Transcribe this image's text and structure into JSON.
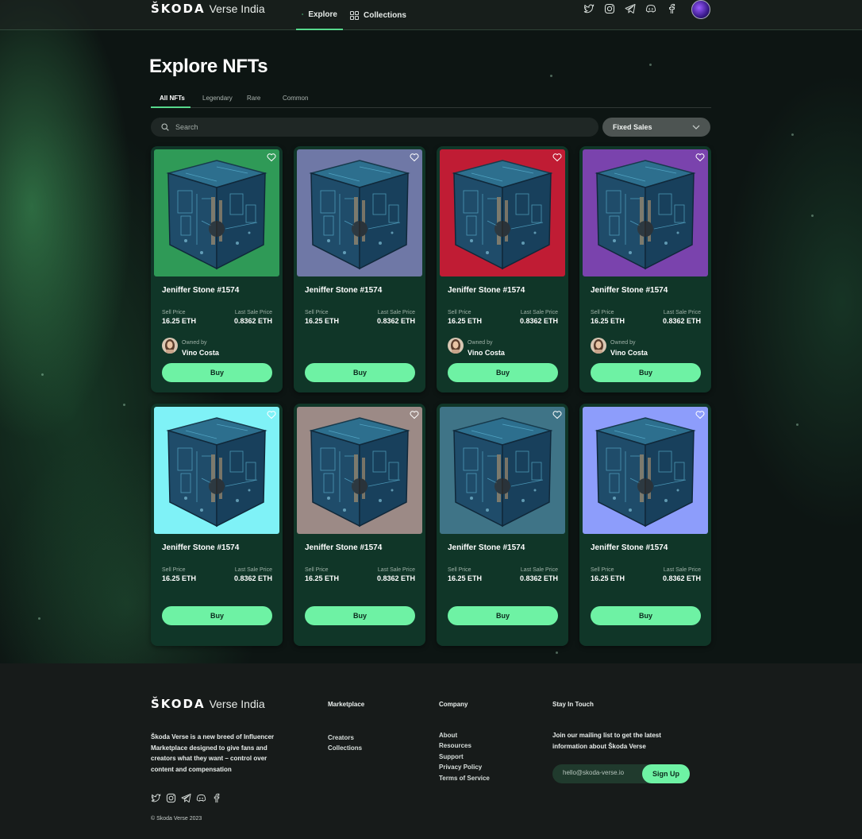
{
  "header": {
    "brand_logo": "ŠKODA",
    "brand_sub": "Verse India",
    "nav": [
      {
        "label": "Explore",
        "icon": "asterisk-icon",
        "active": true
      },
      {
        "label": "Collections",
        "icon": "grid-icon",
        "active": false
      }
    ],
    "socials": [
      "twitter-icon",
      "instagram-icon",
      "telegram-icon",
      "discord-icon",
      "facebook-icon"
    ]
  },
  "page": {
    "title": "Explore NFTs",
    "tabs": [
      "All NFTs",
      "Legendary",
      "Rare",
      "Common"
    ],
    "active_tab": "All NFTs",
    "search_placeholder": "Search",
    "filter_label": "Fixed Sales"
  },
  "labels": {
    "sell_price": "Sell Price",
    "last_sale_price": "Last Sale Price",
    "owned_by": "Owned by",
    "buy": "Buy"
  },
  "cards": [
    {
      "name": "Jeniffer Stone #1574",
      "sell_price": "16.25 ETH",
      "last_sale": "0.8362 ETH",
      "owner": "Vino Costa",
      "bg": "#2f9a57"
    },
    {
      "name": "Jeniffer Stone #1574",
      "sell_price": "16.25 ETH",
      "last_sale": "0.8362 ETH",
      "owner": null,
      "bg": "#6f78a6"
    },
    {
      "name": "Jeniffer Stone #1574",
      "sell_price": "16.25 ETH",
      "last_sale": "0.8362 ETH",
      "owner": "Vino Costa",
      "bg": "#c01c34"
    },
    {
      "name": "Jeniffer Stone #1574",
      "sell_price": "16.25 ETH",
      "last_sale": "0.8362 ETH",
      "owner": "Vino Costa",
      "bg": "#7a43ad"
    },
    {
      "name": "Jeniffer Stone #1574",
      "sell_price": "16.25 ETH",
      "last_sale": "0.8362 ETH",
      "owner": null,
      "bg": "#7ff2f7"
    },
    {
      "name": "Jeniffer Stone #1574",
      "sell_price": "16.25 ETH",
      "last_sale": "0.8362 ETH",
      "owner": null,
      "bg": "#9c8a86"
    },
    {
      "name": "Jeniffer Stone #1574",
      "sell_price": "16.25 ETH",
      "last_sale": "0.8362 ETH",
      "owner": null,
      "bg": "#3f7487"
    },
    {
      "name": "Jeniffer Stone #1574",
      "sell_price": "16.25 ETH",
      "last_sale": "0.8362 ETH",
      "owner": null,
      "bg": "#8d9dfb"
    }
  ],
  "footer": {
    "brand_logo": "ŠKODA",
    "brand_sub": "Verse India",
    "description": "Škoda Verse is a new breed of Influencer Marketplace designed to give fans and creators what they want – control over content and compensation",
    "copyright": "© Skoda Verse 2023",
    "marketplace": {
      "title": "Marketplace",
      "links": [
        "Creators",
        "Collections"
      ]
    },
    "company": {
      "title": "Company",
      "links": [
        "About",
        "Resources",
        "Support",
        "Privacy Policy",
        "Terms of Service"
      ]
    },
    "touch": {
      "title": "Stay In Touch",
      "text": "Join our mailing list to get the latest information about Škoda Verse",
      "email_placeholder": "hello@skoda-verse.io",
      "signup": "Sign Up"
    }
  },
  "colors": {
    "accent": "#6ef2a4",
    "card_bg": "#103628",
    "footer_bg": "#171b1a"
  }
}
